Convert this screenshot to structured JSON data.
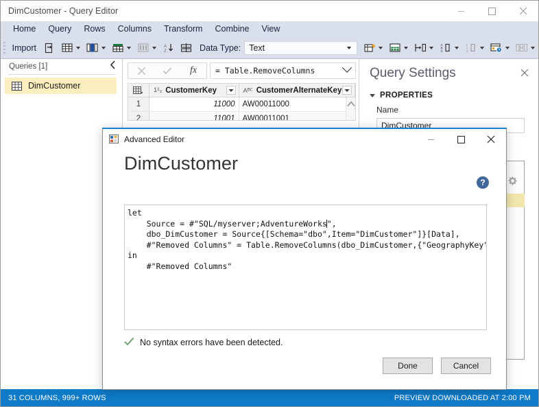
{
  "window": {
    "title": "DimCustomer - Query Editor",
    "controls": [
      {
        "name": "minimize",
        "glyph": "minimize-icon"
      },
      {
        "name": "maximize",
        "glyph": "maximize-icon"
      },
      {
        "name": "close",
        "glyph": "close-icon"
      }
    ]
  },
  "ribbon": {
    "tabs": [
      "Home",
      "Query",
      "Rows",
      "Columns",
      "Transform",
      "Combine",
      "View"
    ],
    "active_tab": "Home",
    "toolbar": {
      "import_label": "Import",
      "data_type_label": "Data Type:",
      "data_type_value": "Text",
      "buttons": [
        {
          "name": "import-data-icon",
          "label": "Import"
        },
        {
          "name": "refresh-preview-icon",
          "label": ""
        },
        {
          "name": "choose-columns-icon",
          "label": ""
        },
        {
          "name": "remove-columns-icon",
          "label": ""
        },
        {
          "name": "keep-rows-icon",
          "label": ""
        },
        {
          "name": "remove-rows-icon",
          "label": ""
        },
        {
          "name": "sort-ascending-icon",
          "label": ""
        },
        {
          "name": "split-column-icon",
          "label": ""
        },
        {
          "name": "group-by-icon",
          "label": ""
        },
        {
          "name": "use-first-row-as-headers-icon",
          "label": ""
        },
        {
          "name": "replace-values-icon",
          "label": ""
        },
        {
          "name": "text-column-icon",
          "label": ""
        },
        {
          "name": "number-column-icon",
          "label": ""
        },
        {
          "name": "date-time-column-icon",
          "label": ""
        },
        {
          "name": "merge-queries-icon",
          "label": ""
        }
      ]
    }
  },
  "queries_pane": {
    "header": "Queries [1]",
    "collapse_icon": "chevron-left-icon",
    "items": [
      {
        "label": "DimCustomer",
        "icon": "table-icon",
        "selected": true
      }
    ]
  },
  "formula_bar": {
    "cancel_icon": "cancel-x-icon",
    "accept_icon": "accept-check-icon",
    "fx_icon": "fx-icon",
    "value": "= Table.RemoveColumns",
    "expand_icon": "chevron-down-icon"
  },
  "data_grid": {
    "select_all_icon": "select-all-table-icon",
    "columns": [
      {
        "name": "CustomerKey",
        "type_glyph": "1²₃",
        "type": "whole-number",
        "filter_icon": "filter-dropdown-icon"
      },
      {
        "name": "CustomerAlternateKey",
        "type_glyph": "Aᴮꟲ",
        "type": "text",
        "filter_icon": "filter-dropdown-icon"
      }
    ],
    "rows": [
      {
        "num": "1",
        "CustomerKey": "11000",
        "CustomerAlternateKey": "AW00011000"
      },
      {
        "num": "2",
        "CustomerKey": "11001",
        "CustomerAlternateKey": "AW00011001"
      }
    ],
    "scroll_up_icon": "chevron-up-icon"
  },
  "query_settings": {
    "title": "Query Settings",
    "close_icon": "close-icon",
    "properties_section": "PROPERTIES",
    "name_label": "Name",
    "name_value": "DimCustomer",
    "applied_steps_gear_icon": "gear-icon"
  },
  "dialog": {
    "title": "Advanced Editor",
    "app_icon": "advanced-editor-icon",
    "heading": "DimCustomer",
    "help_icon": "help-question-icon",
    "controls": [
      {
        "name": "minimize",
        "glyph": "minimize-icon"
      },
      {
        "name": "maximize",
        "glyph": "maximize-icon"
      },
      {
        "name": "close",
        "glyph": "close-icon"
      }
    ],
    "code_before_caret": "let\n    Source = #\"SQL/myserver;AdventureWorks",
    "code_after_caret": "\",\n    dbo_DimCustomer = Source{[Schema=\"dbo\",Item=\"DimCustomer\"]}[Data],\n    #\"Removed Columns\" = Table.RemoveColumns(dbo_DimCustomer,{\"GeographyKey\"})\nin\n    #\"Removed Columns\"",
    "syntax_status": "No syntax errors have been detected.",
    "syntax_status_icon": "green-check-icon",
    "done_label": "Done",
    "cancel_label": "Cancel"
  },
  "status_bar": {
    "left": "31 COLUMNS, 999+ ROWS",
    "right": "PREVIEW DOWNLOADED AT 2:00 PM"
  },
  "colors": {
    "ribbon_bg": "#d9dfeb",
    "status_bar_bg": "#0f7ac7",
    "selection_yellow": "#fbefbf",
    "dialog_accent": "#1783d6",
    "help_blue": "#41699e",
    "check_green": "#4f8a4f"
  }
}
